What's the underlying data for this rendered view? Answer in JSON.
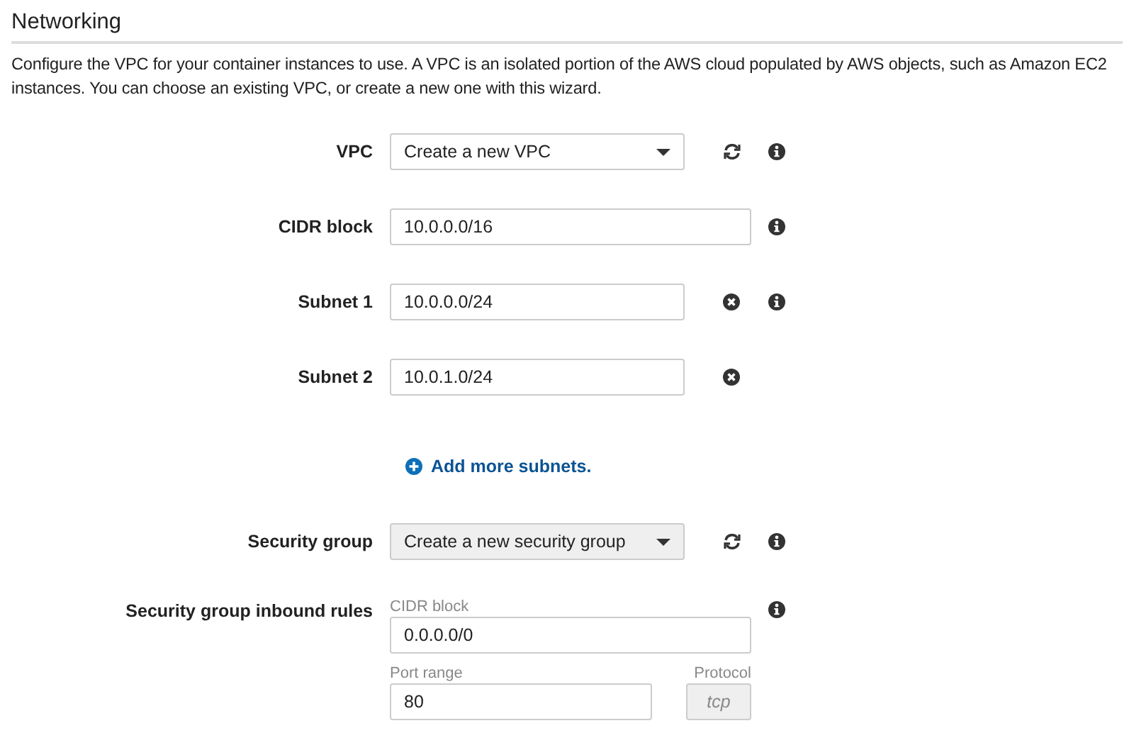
{
  "section": {
    "title": "Networking",
    "description": "Configure the VPC for your container instances to use. A VPC is an isolated portion of the AWS cloud populated by AWS objects, such as Amazon EC2 instances. You can choose an existing VPC, or create a new one with this wizard."
  },
  "rows": [
    {
      "kind": "select",
      "label": "VPC",
      "value": "Create a new VPC",
      "shaded": false,
      "refresh": true,
      "info": true
    },
    {
      "kind": "input",
      "label": "CIDR block",
      "value": "10.0.0.0/16",
      "remove": false,
      "info": true
    },
    {
      "kind": "input",
      "label": "Subnet 1",
      "value": "10.0.0.0/24",
      "remove": true,
      "info": true
    },
    {
      "kind": "input",
      "label": "Subnet 2",
      "value": "10.0.1.0/24",
      "remove": true,
      "info": false
    },
    {
      "kind": "link",
      "text": "Add more subnets."
    },
    {
      "kind": "select",
      "label": "Security group",
      "value": "Create a new security group",
      "shaded": true,
      "refresh": true,
      "info": true
    },
    {
      "kind": "rules",
      "label": "Security group inbound rules",
      "info": true,
      "cidr": {
        "label": "CIDR block",
        "value": "0.0.0.0/0"
      },
      "port": {
        "label": "Port range",
        "value": "80"
      },
      "protocol": {
        "label": "Protocol",
        "value": "tcp",
        "disabled": true
      }
    }
  ]
}
